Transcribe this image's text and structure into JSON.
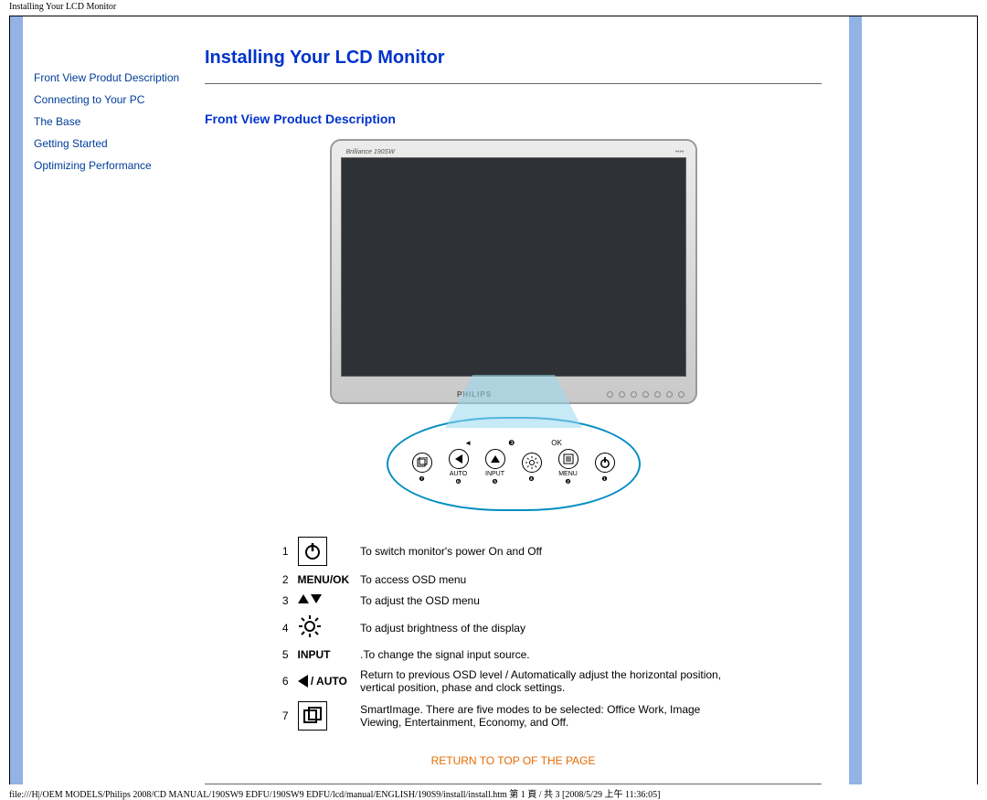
{
  "header": {
    "doc_title": "Installing Your LCD Monitor"
  },
  "sidebar": {
    "items": [
      {
        "label": "Front View Produt Description"
      },
      {
        "label": "Connecting to Your PC"
      },
      {
        "label": "The Base"
      },
      {
        "label": "Getting Started"
      },
      {
        "label": "Optimizing Performance"
      }
    ]
  },
  "page": {
    "title": "Installing Your LCD Monitor",
    "section_title": "Front View Product Description",
    "return_link": "RETURN TO TOP OF THE PAGE"
  },
  "monitor": {
    "brand_top": "Brilliance 190SW",
    "brand_bottom": "PHILIPS",
    "callout_top_labels": [
      "◄",
      "►",
      "OK"
    ],
    "callout_labels": [
      "",
      "AUTO",
      "INPUT",
      "",
      "MENU",
      ""
    ],
    "callout_numbers": [
      "❼",
      "❻",
      "❺",
      "❹",
      "❸",
      "❷",
      "❶"
    ]
  },
  "legend": {
    "rows": [
      {
        "num": "1",
        "label": "",
        "desc": "To switch monitor's power On and Off"
      },
      {
        "num": "2",
        "label": "MENU/OK",
        "desc": "To access OSD menu"
      },
      {
        "num": "3",
        "label": "",
        "desc": "To adjust the OSD menu"
      },
      {
        "num": "4",
        "label": "",
        "desc": "To adjust brightness of the display"
      },
      {
        "num": "5",
        "label": "INPUT",
        "desc": ".To change the signal input source."
      },
      {
        "num": "6",
        "label": " / AUTO",
        "desc": "Return to previous OSD level / Automatically adjust the horizontal position, vertical position, phase and clock settings."
      },
      {
        "num": "7",
        "label": "",
        "desc": "SmartImage. There are five modes to be selected: Office Work, Image Viewing, Entertainment, Economy, and Off."
      }
    ]
  },
  "footer": {
    "path": "file:///H|/OEM MODELS/Philips 2008/CD MANUAL/190SW9 EDFU/190SW9 EDFU/lcd/manual/ENGLISH/190S9/install/install.htm 第 1 頁 / 共 3  [2008/5/29 上午 11:36:05]"
  }
}
